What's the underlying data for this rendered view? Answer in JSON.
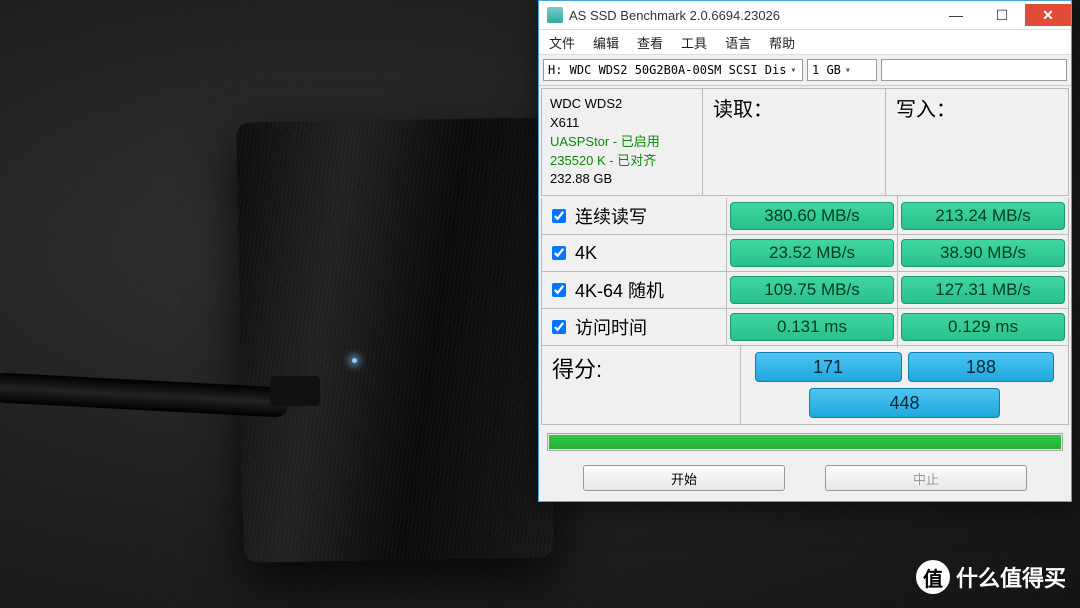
{
  "watermark": "什么值得买",
  "window": {
    "title": "AS SSD Benchmark 2.0.6694.23026",
    "buttons": {
      "minimize": "—",
      "maximize": "☐",
      "close": "✕"
    }
  },
  "menu": {
    "file": "文件",
    "edit": "编辑",
    "view": "查看",
    "tools": "工具",
    "lang": "语言",
    "help": "帮助"
  },
  "toolbar": {
    "drive": "H: WDC WDS2 50G2B0A-00SM SCSI Dis",
    "size": "1 GB"
  },
  "info": {
    "model": "WDC WDS2",
    "chip": "X611",
    "uasp": "UASPStor - 已启用",
    "align": "235520 K - 已对齐",
    "capacity": "232.88 GB"
  },
  "headers": {
    "read": "读取：",
    "write": "写入："
  },
  "tests": {
    "seq": {
      "label": "连续读写",
      "read": "380.60 MB/s",
      "write": "213.24 MB/s"
    },
    "k4": {
      "label": "4K",
      "read": "23.52 MB/s",
      "write": "38.90 MB/s"
    },
    "k464": {
      "label": "4K-64 随机",
      "read": "109.75 MB/s",
      "write": "127.31 MB/s"
    },
    "acc": {
      "label": "访问时间",
      "read": "0.131 ms",
      "write": "0.129 ms"
    }
  },
  "score": {
    "label": "得分:",
    "read": "171",
    "write": "188",
    "total": "448"
  },
  "buttons": {
    "start": "开始",
    "stop": "中止"
  }
}
